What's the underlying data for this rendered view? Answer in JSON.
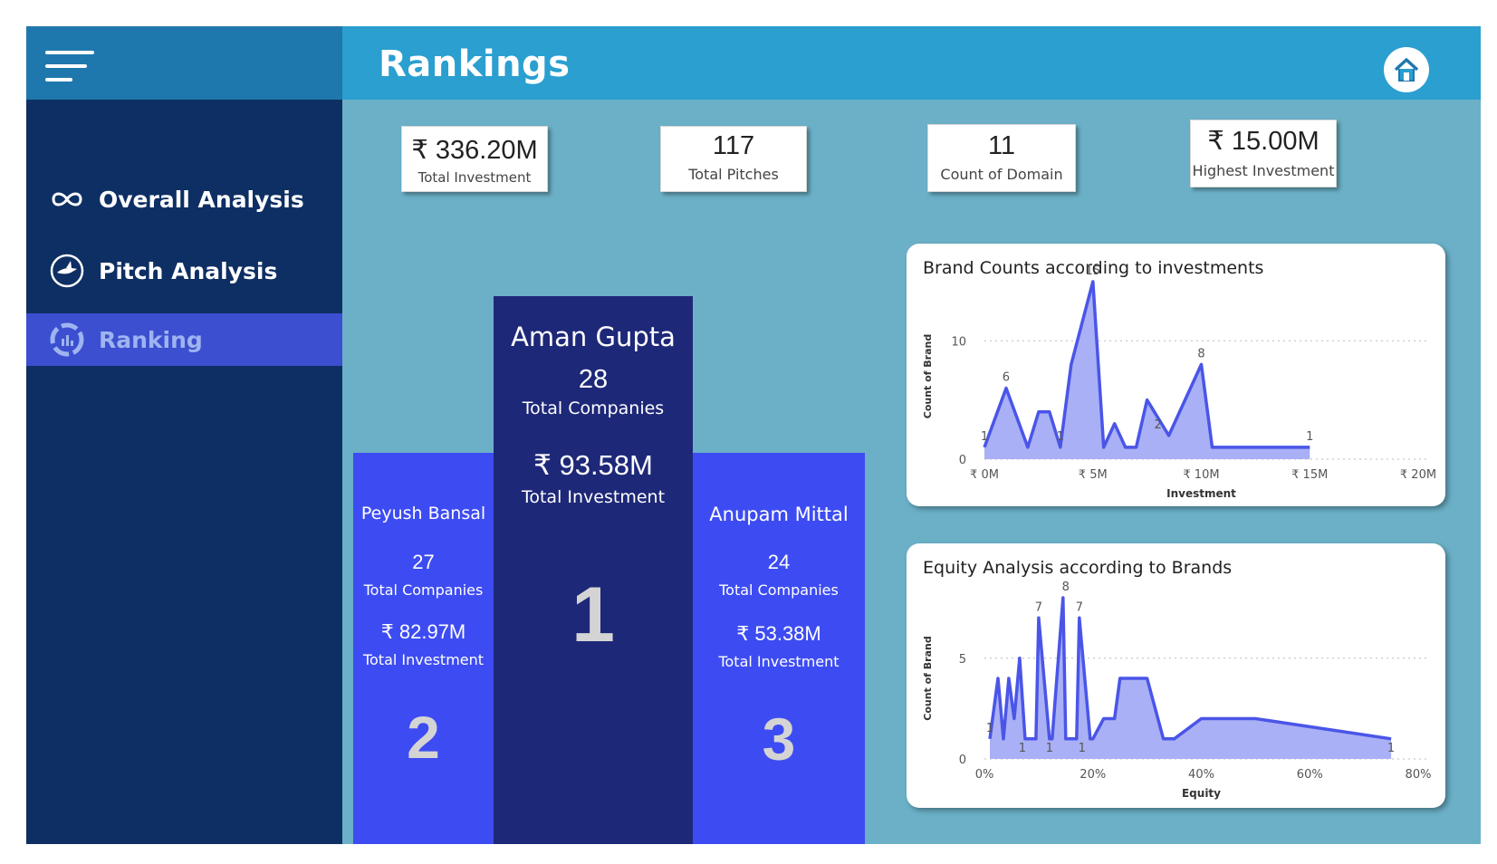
{
  "header": {
    "title": "Rankings"
  },
  "sidebar": {
    "items": [
      {
        "label": "Overall Analysis",
        "icon": "infinity-icon"
      },
      {
        "label": "Pitch Analysis",
        "icon": "shark-icon"
      },
      {
        "label": "Ranking",
        "icon": "ranking-icon"
      }
    ],
    "active": "Ranking"
  },
  "kpis": [
    {
      "value": "₹ 336.20M",
      "label": "Total Investment"
    },
    {
      "value": "117",
      "label": "Total Pitches"
    },
    {
      "value": "11",
      "label": "Count of Domain"
    },
    {
      "value": "₹ 15.00M",
      "label": "Highest Investment"
    }
  ],
  "podium": {
    "first": {
      "name": "Aman Gupta",
      "companies": "28",
      "companies_label": "Total Companies",
      "investment": "₹ 93.58M",
      "investment_label": "Total Investment",
      "rank": "1"
    },
    "second": {
      "name": "Peyush Bansal",
      "companies": "27",
      "companies_label": "Total Companies",
      "investment": "₹ 82.97M",
      "investment_label": "Total Investment",
      "rank": "2"
    },
    "third": {
      "name": "Anupam Mittal",
      "companies": "24",
      "companies_label": "Total Companies",
      "investment": "₹ 53.38M",
      "investment_label": "Total Investment",
      "rank": "3"
    }
  },
  "colors": {
    "first": "#1e2878",
    "podium": "#3d4cf2",
    "line": "#4a55e8",
    "area": "#aab0f5",
    "sidebar": "#0e2f63",
    "topbar": "#2a9fd0"
  },
  "chart_data": [
    {
      "type": "area",
      "title": "Brand Counts according to investments",
      "xlabel": "Investment",
      "ylabel": "Count of Brand",
      "xlim": [
        0,
        20
      ],
      "ylim": [
        0,
        14
      ],
      "x_ticks": [
        0,
        5,
        10,
        15,
        20
      ],
      "x_tick_labels": [
        "₹ 0M",
        "₹ 5M",
        "₹ 10M",
        "₹ 15M",
        "₹ 20M"
      ],
      "y_ticks": [
        0,
        10
      ],
      "y_tick_labels": [
        "0",
        "10"
      ],
      "grid": true,
      "x": [
        0,
        1,
        2,
        2.5,
        3,
        3.5,
        4,
        5,
        5.5,
        6,
        6.5,
        7,
        7.5,
        8.5,
        10,
        10.5,
        15
      ],
      "values": [
        1,
        6,
        1,
        4,
        4,
        1,
        8,
        15,
        1,
        3,
        1,
        1,
        5,
        2,
        8,
        1,
        1
      ],
      "data_labels": [
        {
          "x": 0,
          "y": 1,
          "text": "1"
        },
        {
          "x": 1,
          "y": 6,
          "text": "6"
        },
        {
          "x": 3.5,
          "y": 1,
          "text": "1"
        },
        {
          "x": 5,
          "y": 15,
          "text": "15"
        },
        {
          "x": 8,
          "y": 2,
          "text": "2"
        },
        {
          "x": 10,
          "y": 8,
          "text": "8"
        },
        {
          "x": 15,
          "y": 1,
          "text": "1"
        }
      ]
    },
    {
      "type": "area",
      "title": "Equity Analysis according to Brands",
      "xlabel": "Equity",
      "ylabel": "Count of Brand",
      "xlim": [
        0,
        80
      ],
      "ylim": [
        0,
        8
      ],
      "x_ticks": [
        0,
        20,
        40,
        60,
        80
      ],
      "x_tick_labels": [
        "0%",
        "20%",
        "40%",
        "60%",
        "80%"
      ],
      "y_ticks": [
        0,
        5
      ],
      "y_tick_labels": [
        "0",
        "5"
      ],
      "grid": true,
      "x": [
        1,
        2.5,
        3.5,
        4.5,
        5.5,
        6.5,
        7.5,
        9.5,
        10,
        12,
        12.5,
        14.5,
        15,
        17,
        17.5,
        19.5,
        20,
        22,
        24,
        25,
        26,
        30,
        33,
        35,
        40,
        50,
        75
      ],
      "values": [
        1,
        4,
        1,
        4,
        2,
        5,
        1,
        1,
        7,
        1,
        1,
        8,
        1,
        1,
        7,
        1,
        1,
        2,
        2,
        4,
        4,
        4,
        1,
        1,
        2,
        2,
        1
      ],
      "data_labels": [
        {
          "x": 1,
          "y": 1,
          "text": "1"
        },
        {
          "x": 7,
          "y": 0,
          "text": "1"
        },
        {
          "x": 10,
          "y": 7,
          "text": "7"
        },
        {
          "x": 12,
          "y": 0,
          "text": "1"
        },
        {
          "x": 15,
          "y": 8,
          "text": "8"
        },
        {
          "x": 17.5,
          "y": 7,
          "text": "7"
        },
        {
          "x": 18,
          "y": 0,
          "text": "1"
        },
        {
          "x": 75,
          "y": 0,
          "text": "1"
        }
      ]
    }
  ]
}
